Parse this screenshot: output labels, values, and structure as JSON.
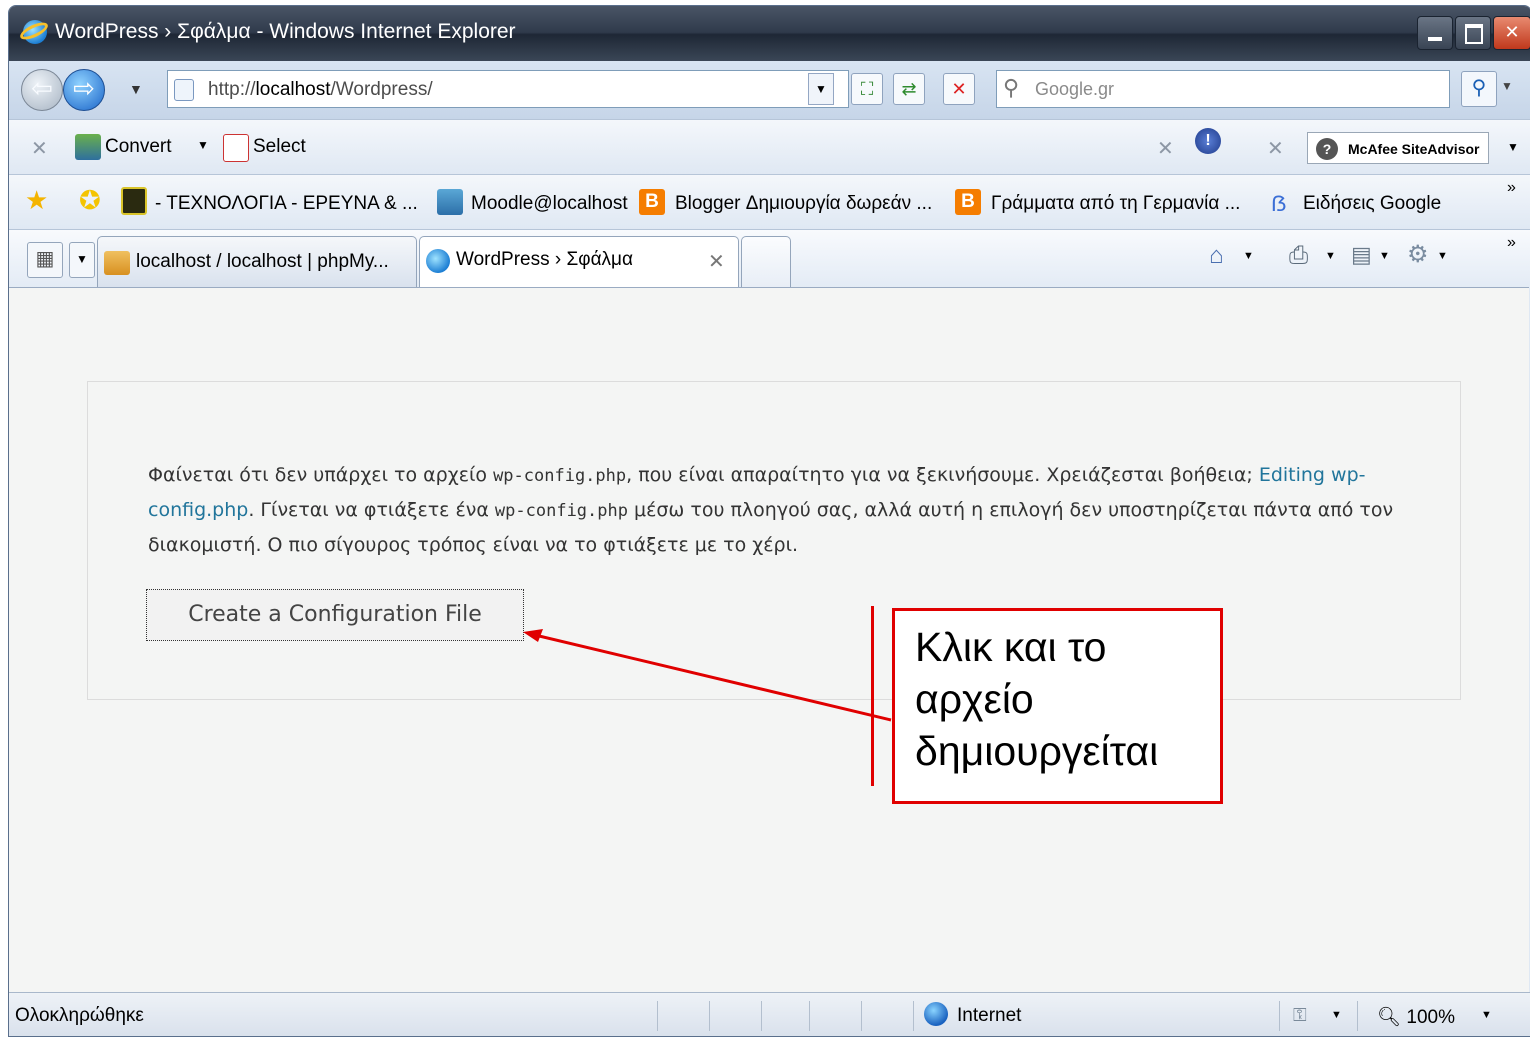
{
  "window": {
    "title": "WordPress › Σφάλμα - Windows Internet Explorer"
  },
  "address_bar": {
    "url_prefix": "http://",
    "url_host": "localhost",
    "url_path": "/Wordpress/",
    "search_placeholder": "Google.gr"
  },
  "toolbar": {
    "convert_label": "Convert",
    "select_label": "Select",
    "mcafee_label": "McAfee SiteAdvisor"
  },
  "favorites": [
    "- ΤΕΧΝΟΛΟΓΙΑ - ΕΡΕΥΝΑ & ...",
    "Moodle@localhost",
    "Blogger Δημιουργία δωρεάν ...",
    "Γράμματα από τη Γερμανία ...",
    "Ειδήσεις Google"
  ],
  "tabs": [
    {
      "label": "localhost / localhost | phpMy..."
    },
    {
      "label": "WordPress › Σφάλμα"
    }
  ],
  "page": {
    "text_part1": "Φαίνεται ότι δεν υπάρχει το αρχείο ",
    "code1": "wp-config.php",
    "text_part2": ", που είναι απαραίτητο για να ξεκινήσουμε. Χρειάζεσται βοήθεια; ",
    "link": "Editing wp-config.php",
    "text_part3": ". Γίνεται να φτιάξετε ένα ",
    "code2": "wp-config.php",
    "text_part4": " μέσω του πλοηγού σας, αλλά αυτή η επιλογή δεν υποστηρίζεται πάντα από τον διακομιστή. Ο πιο σίγουρος τρόπος είναι να το φτιάξετε με το χέρι.",
    "button": "Create a Configuration File"
  },
  "annotation": {
    "line1": "Κλικ και το",
    "line2": "αρχείο",
    "line3": "δημιουργείται"
  },
  "status_bar": {
    "status": "Ολοκληρώθηκε",
    "zone": "Internet",
    "zoom": "100%"
  },
  "colors": {
    "annotation_red": "#e00000",
    "link_blue": "#21759b"
  }
}
